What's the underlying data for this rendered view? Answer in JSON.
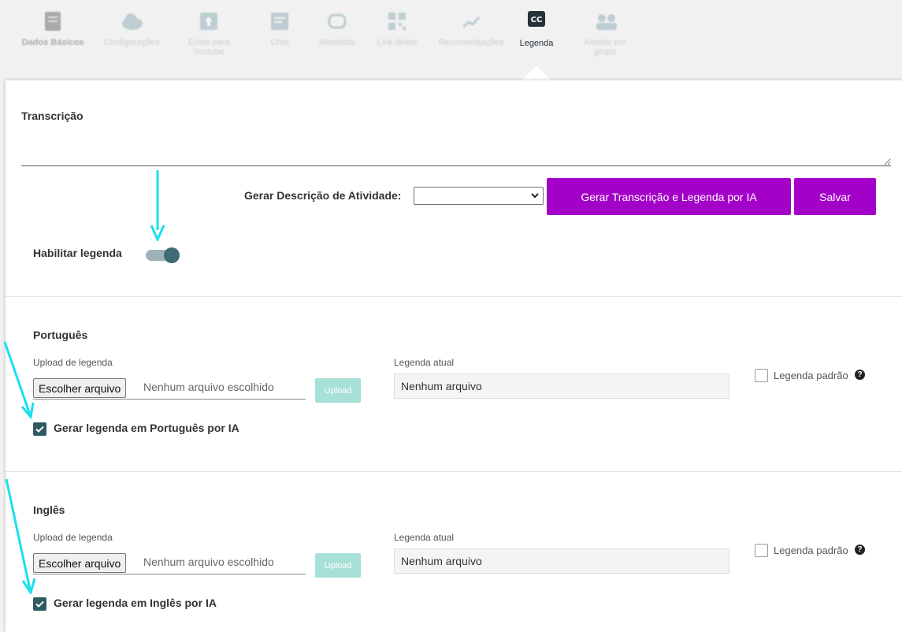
{
  "tabs": [
    {
      "label": "Dados Básicos",
      "icon": "file-icon"
    },
    {
      "label": "Configurações",
      "icon": "cloud-icon"
    },
    {
      "label": "Envio para Youtube",
      "icon": "upload-icon"
    },
    {
      "label": "Chat",
      "icon": "chat-icon"
    },
    {
      "label": "Metadata",
      "icon": "tag-icon"
    },
    {
      "label": "Link direto",
      "icon": "qr-icon"
    },
    {
      "label": "Recomendações",
      "icon": "graph-icon"
    },
    {
      "label": "Legenda",
      "icon": "closed-captions-icon"
    },
    {
      "label": "Assistir em grupo",
      "icon": "group-icon"
    }
  ],
  "transcription": {
    "title": "Transcrição",
    "value": ""
  },
  "activity": {
    "label": "Gerar Descrição de Atividade:",
    "selected": ""
  },
  "buttons": {
    "generate_ai": "Gerar Transcrição e Legenda por IA",
    "save": "Salvar"
  },
  "toggle": {
    "label": "Habilitar legenda",
    "on": true
  },
  "languages": [
    {
      "title": "Português",
      "upload_label": "Upload de legenda",
      "file_button": "Escolher arquivo",
      "file_status": "Nenhum arquivo escolhido",
      "upload_button": "Upload",
      "current_label": "Legenda atual",
      "current_value": "Nenhum arquivo",
      "default_label": "Legenda padrão",
      "default_checked": false,
      "ai_label": "Gerar legenda em Português por IA",
      "ai_checked": true
    },
    {
      "title": "Inglês",
      "upload_label": "Upload de legenda",
      "file_button": "Escolher arquivo",
      "file_status": "Nenhum arquivo escolhido",
      "upload_button": "Upload",
      "current_label": "Legenda atual",
      "current_value": "Nenhum arquivo",
      "default_label": "Legenda padrão",
      "default_checked": false,
      "ai_label": "Gerar legenda em Inglês por IA",
      "ai_checked": true
    }
  ],
  "colors": {
    "accent_purple": "#a300c8",
    "toggle_knob": "#406b74",
    "checkbox_checked": "#2f5a63",
    "upload_button": "#a6e0d6",
    "annotation_arrow": "#18e0ee"
  }
}
